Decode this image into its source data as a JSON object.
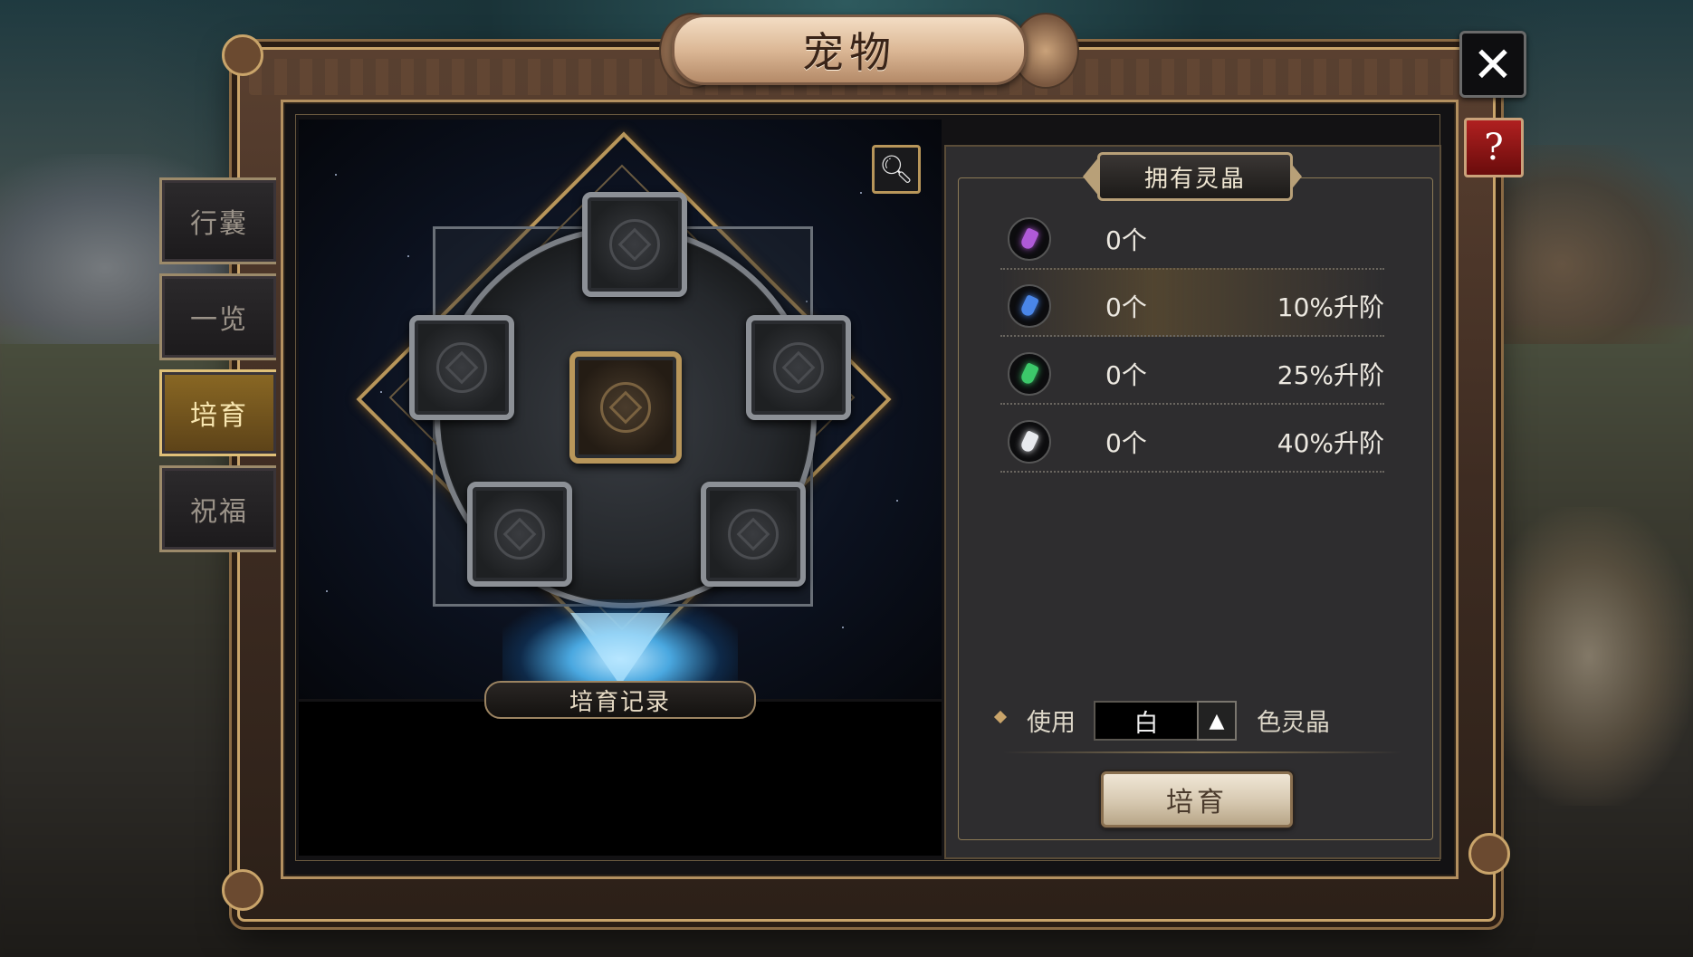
{
  "window": {
    "title": "宠物"
  },
  "controls": {
    "close_icon": "close-icon",
    "help_label": "?"
  },
  "tabs": [
    {
      "label": "行囊",
      "active": false
    },
    {
      "label": "一览",
      "active": false
    },
    {
      "label": "培育",
      "active": true
    },
    {
      "label": "祝福",
      "active": false
    }
  ],
  "altar": {
    "search_icon": "magnifier-icon",
    "record_label": "培育记录"
  },
  "crystals": {
    "header": "拥有灵晶",
    "items": [
      {
        "color": "#b05ad8",
        "count": "0个",
        "bonus": ""
      },
      {
        "color": "#4a86e8",
        "count": "0个",
        "bonus": "10%升阶"
      },
      {
        "color": "#3cc86a",
        "count": "0个",
        "bonus": "25%升阶"
      },
      {
        "color": "#e8eaee",
        "count": "0个",
        "bonus": "40%升阶"
      }
    ]
  },
  "use": {
    "label": "使用",
    "selected_color": "白",
    "toggle_glyph": "▲",
    "suffix": "色灵晶"
  },
  "action": {
    "cultivate_label": "培育"
  }
}
